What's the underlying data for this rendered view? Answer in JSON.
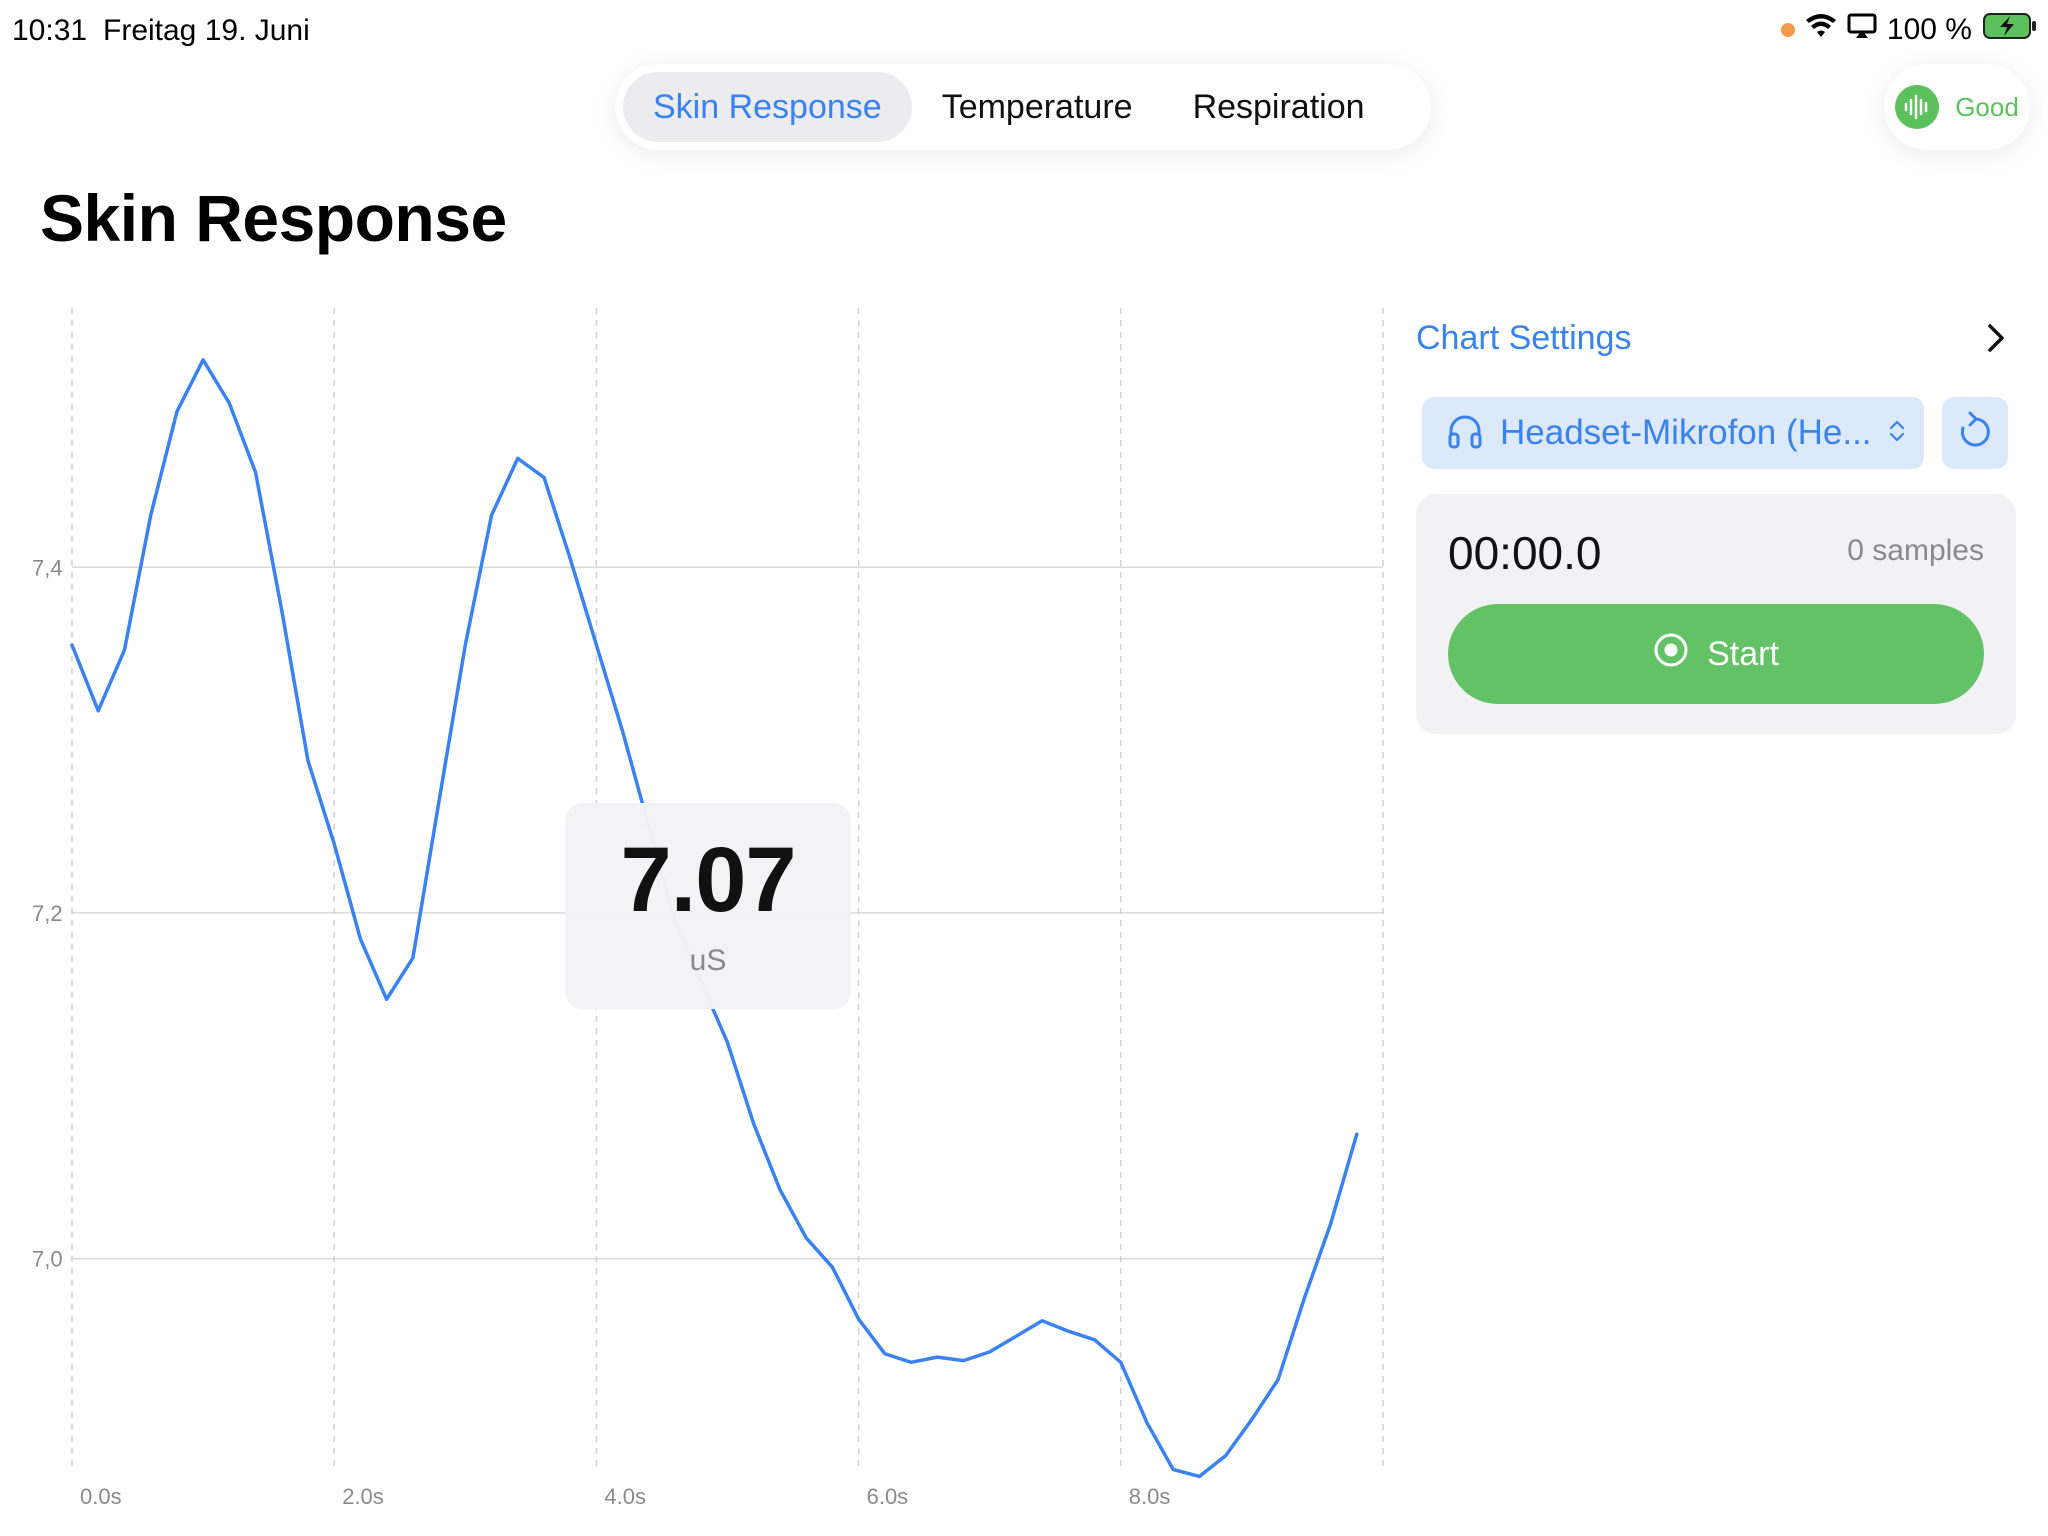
{
  "status_bar": {
    "time": "10:31",
    "date": "Freitag 19. Juni",
    "battery": "100 %"
  },
  "tabs": [
    {
      "label": "Skin Response",
      "active": true
    },
    {
      "label": "Temperature",
      "active": false
    },
    {
      "label": "Respiration",
      "active": false
    }
  ],
  "signal": {
    "label": "Good",
    "color": "#5cc15d"
  },
  "page_title": "Skin Response",
  "current_value": {
    "value": "7.07",
    "unit": "uS"
  },
  "panel": {
    "chart_settings_label": "Chart Settings",
    "device_label": "Headset-Mikrofon (He...",
    "timer": "00:00.0",
    "samples": "0 samples",
    "start_label": "Start"
  },
  "colors": {
    "accent": "#3a82f0",
    "start_green": "#62c265",
    "line": "#3a82f0"
  },
  "chart_data": {
    "type": "line",
    "xlabel": "",
    "ylabel": "",
    "xlim": [
      0,
      10
    ],
    "ylim": [
      6.88,
      7.55
    ],
    "x_ticks": [
      0,
      2,
      4,
      6,
      8
    ],
    "x_tick_labels": [
      "0.0s",
      "2.0s",
      "4.0s",
      "6.0s",
      "8.0s"
    ],
    "y_ticks": [
      7.0,
      7.2,
      7.4
    ],
    "y_tick_labels": [
      "7,0",
      "7,2",
      "7,4"
    ],
    "grid": true,
    "series": [
      {
        "values": [
          [
            0.0,
            7.355
          ],
          [
            0.2,
            7.317
          ],
          [
            0.4,
            7.352
          ],
          [
            0.6,
            7.43
          ],
          [
            0.8,
            7.49
          ],
          [
            1.0,
            7.52
          ],
          [
            1.2,
            7.495
          ],
          [
            1.4,
            7.455
          ],
          [
            1.6,
            7.375
          ],
          [
            1.8,
            7.288
          ],
          [
            2.0,
            7.24
          ],
          [
            2.2,
            7.185
          ],
          [
            2.4,
            7.15
          ],
          [
            2.6,
            7.174
          ],
          [
            2.8,
            7.265
          ],
          [
            3.0,
            7.355
          ],
          [
            3.2,
            7.43
          ],
          [
            3.4,
            7.463
          ],
          [
            3.6,
            7.452
          ],
          [
            3.8,
            7.405
          ],
          [
            4.0,
            7.355
          ],
          [
            4.2,
            7.305
          ],
          [
            4.4,
            7.25
          ],
          [
            4.6,
            7.195
          ],
          [
            4.8,
            7.16
          ],
          [
            5.0,
            7.125
          ],
          [
            5.2,
            7.078
          ],
          [
            5.4,
            7.04
          ],
          [
            5.6,
            7.012
          ],
          [
            5.8,
            6.995
          ],
          [
            6.0,
            6.965
          ],
          [
            6.2,
            6.945
          ],
          [
            6.4,
            6.94
          ],
          [
            6.6,
            6.943
          ],
          [
            6.8,
            6.941
          ],
          [
            7.0,
            6.946
          ],
          [
            7.2,
            6.955
          ],
          [
            7.4,
            6.964
          ],
          [
            7.6,
            6.958
          ],
          [
            7.8,
            6.953
          ],
          [
            8.0,
            6.94
          ],
          [
            8.2,
            6.905
          ],
          [
            8.4,
            6.878
          ],
          [
            8.6,
            6.874
          ],
          [
            8.8,
            6.886
          ],
          [
            9.0,
            6.907
          ],
          [
            9.2,
            6.93
          ],
          [
            9.4,
            6.977
          ],
          [
            9.6,
            7.02
          ],
          [
            9.8,
            7.072
          ]
        ]
      }
    ]
  }
}
